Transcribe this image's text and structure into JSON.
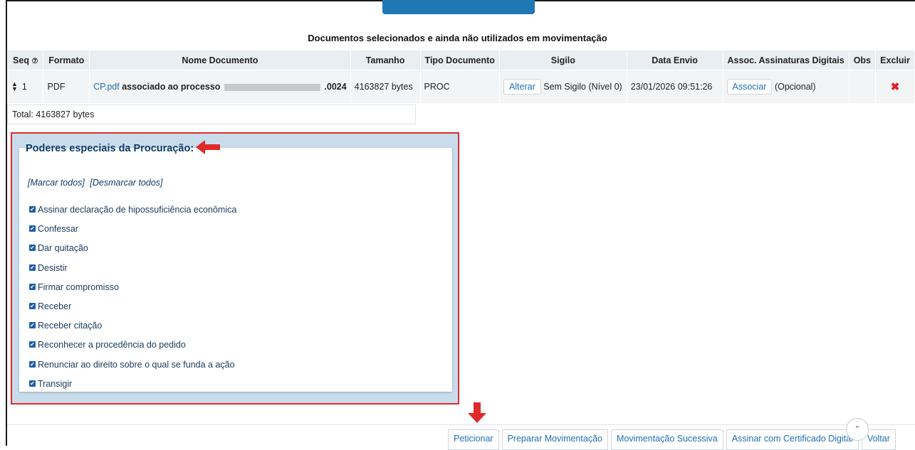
{
  "table": {
    "title": "Documentos selecionados e ainda não utilizados em movimentação",
    "headers": {
      "seq": "Seq",
      "formato": "Formato",
      "nome": "Nome Documento",
      "tamanho": "Tamanho",
      "tipo": "Tipo Documento",
      "sigilo": "Sigilo",
      "data_envio": "Data Envio",
      "assoc": "Assoc. Assinaturas Digitais",
      "obs": "Obs",
      "excluir": "Excluir"
    },
    "row": {
      "seq": "1",
      "formato": "PDF",
      "file_link": "CP.pdf",
      "file_desc": "associado ao processo",
      "process_suffix": ".0024",
      "tamanho": "4163827 bytes",
      "tipo": "PROC",
      "alterar_label": "Alterar",
      "sigilo": "Sem Sigilo (Nível 0)",
      "data_envio": "23/01/2026 09:51:26",
      "associar_label": "Associar",
      "opcional": "(Opcional)"
    },
    "total": "Total: 4163827 bytes"
  },
  "poderes": {
    "legend": "Poderes especiais da Procuração:",
    "marcar_todos": "[Marcar todos]",
    "desmarcar_todos": "[Desmarcar todos]",
    "options": [
      "Assinar declaração de hipossuficiência econômica",
      "Confessar",
      "Dar quitação",
      "Desistir",
      "Firmar compromisso",
      "Receber",
      "Receber citação",
      "Reconhecer a procedência do pedido",
      "Renunciar ao direito sobre o qual se funda a ação",
      "Transigir"
    ]
  },
  "buttons": {
    "peticionar": "Peticionar",
    "preparar": "Preparar Movimentação",
    "sucessiva": "Movimentação Sucessiva",
    "assinar": "Assinar com Certificado Digital",
    "voltar": "Voltar"
  },
  "colors": {
    "accent": "#1f77b4",
    "highlight_border": "#e02a2a",
    "delete": "#e0202a"
  }
}
